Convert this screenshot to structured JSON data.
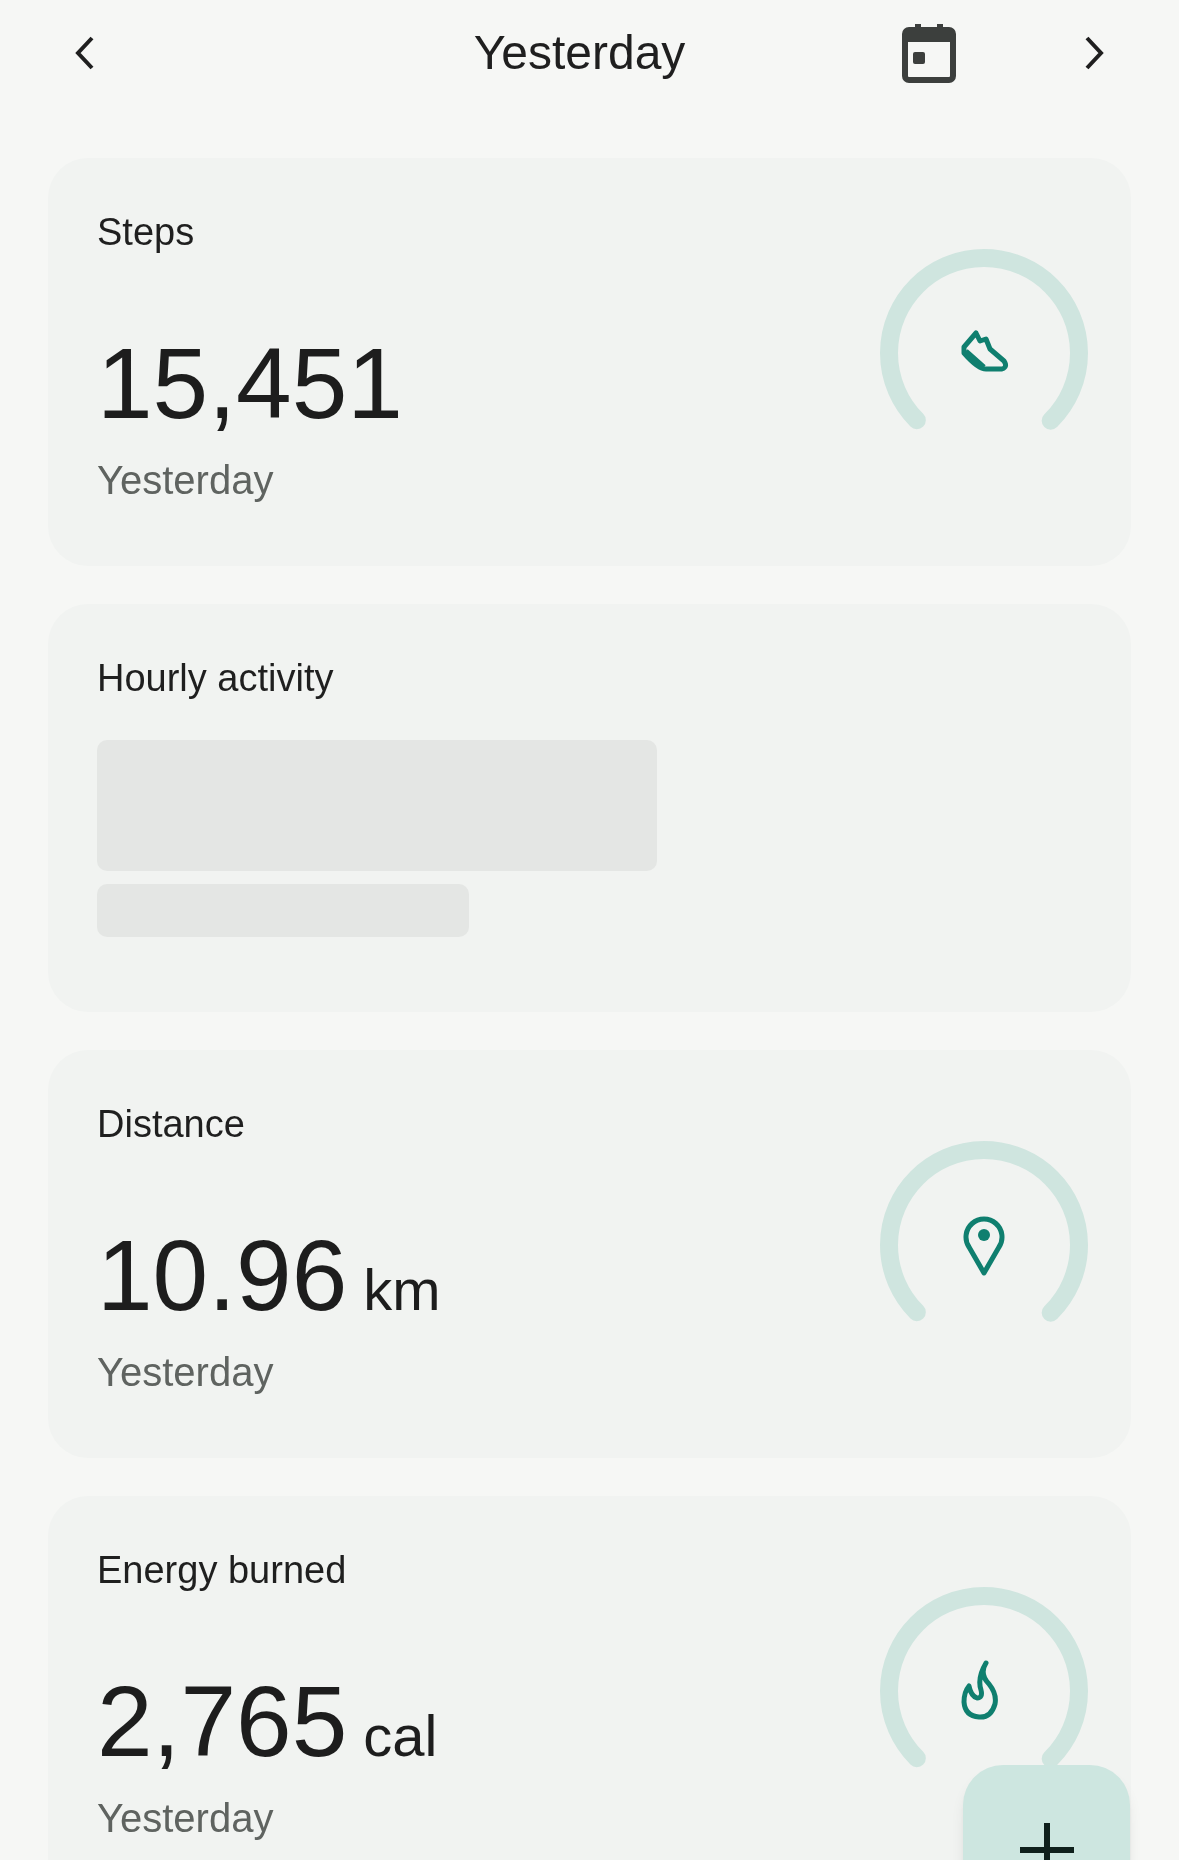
{
  "header": {
    "title": "Yesterday"
  },
  "cards": [
    {
      "kind": "steps",
      "title": "Steps",
      "value": "15,451",
      "caption": "Yesterday"
    },
    {
      "kind": "loading",
      "title": "Hourly activity"
    },
    {
      "kind": "distance",
      "title": "Distance",
      "value": "10.96",
      "unit": "km",
      "caption": "Yesterday"
    },
    {
      "kind": "energy",
      "title": "Energy burned",
      "value": "2,765",
      "unit": "cal",
      "caption": "Yesterday"
    }
  ]
}
